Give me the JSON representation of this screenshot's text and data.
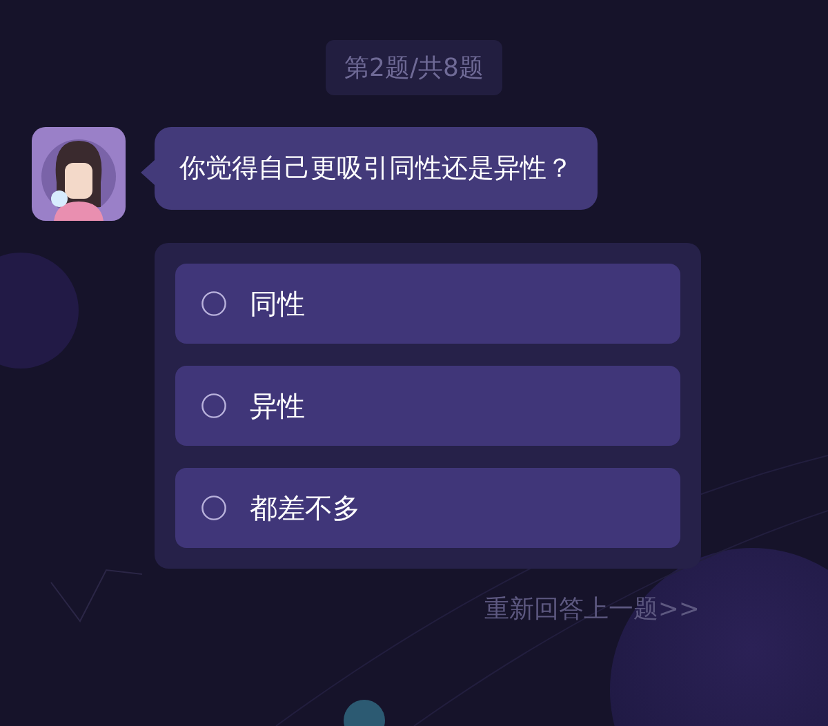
{
  "progress": "第2题/共8题",
  "question": {
    "text": "你觉得自己更吸引同性还是异性？"
  },
  "options": [
    {
      "label": "同性",
      "selected": false
    },
    {
      "label": "异性",
      "selected": false
    },
    {
      "label": "都差不多",
      "selected": false
    }
  ],
  "back_link": "重新回答上一题>>"
}
